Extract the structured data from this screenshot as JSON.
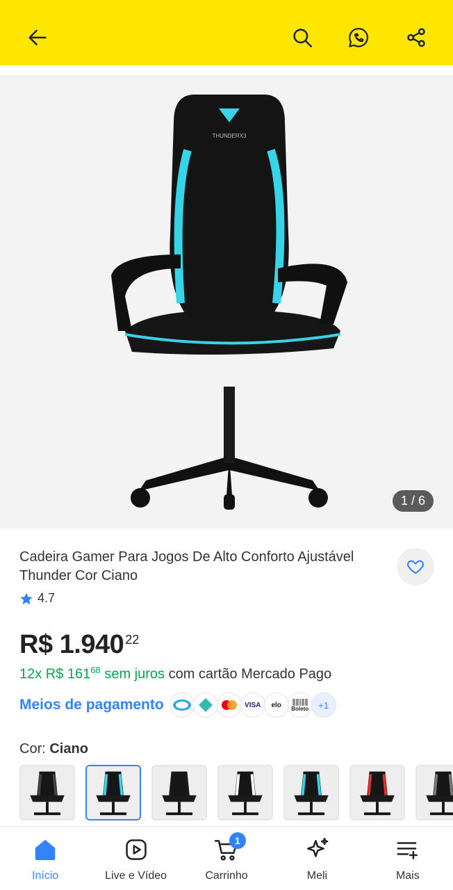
{
  "header": {
    "back_icon": "arrow-left-icon",
    "search_icon": "search-icon",
    "whatsapp_icon": "whatsapp-icon",
    "share_icon": "share-icon",
    "background": "#ffe600"
  },
  "gallery": {
    "counter": "1 / 6",
    "brand_text": "THUNDERX3"
  },
  "product": {
    "title": "Cadeira Gamer Para Jogos De Alto Conforto Ajustável Thunder Cor Ciano",
    "rating": "4.7",
    "price_main": "R$ 1.940",
    "price_cents": "22",
    "installments_prefix": "12x R$ 161",
    "installments_cents": "68",
    "installments_free": "sem juros",
    "installments_suffix": "com cartão Mercado Pago",
    "payment_link": "Meios de pagamento",
    "payment_methods": [
      "mercado-pago",
      "pix",
      "mastercard",
      "VISA",
      "elo",
      "Boleto"
    ],
    "payment_more": "+1",
    "color_label": "Cor:",
    "color_value": "Ciano"
  },
  "variants": [
    {
      "name": "variant-1",
      "selected": false,
      "accent": "#444444"
    },
    {
      "name": "variant-2",
      "selected": true,
      "accent": "#35d4e8"
    },
    {
      "name": "variant-3",
      "selected": false,
      "accent": "#1a1a1a"
    },
    {
      "name": "variant-4",
      "selected": false,
      "accent": "#ffffff"
    },
    {
      "name": "variant-5",
      "selected": false,
      "accent": "#35d4e8"
    },
    {
      "name": "variant-6",
      "selected": false,
      "accent": "#e03030"
    },
    {
      "name": "variant-7",
      "selected": false,
      "accent": "#777777"
    }
  ],
  "nav": {
    "home": "Início",
    "live": "Live e Vídeo",
    "cart": "Carrinho",
    "cart_badge": "1",
    "meli": "Meli",
    "more": "Mais"
  },
  "colors": {
    "accent_blue": "#3483fa",
    "green": "#00a650",
    "cyan": "#35d4e8"
  }
}
